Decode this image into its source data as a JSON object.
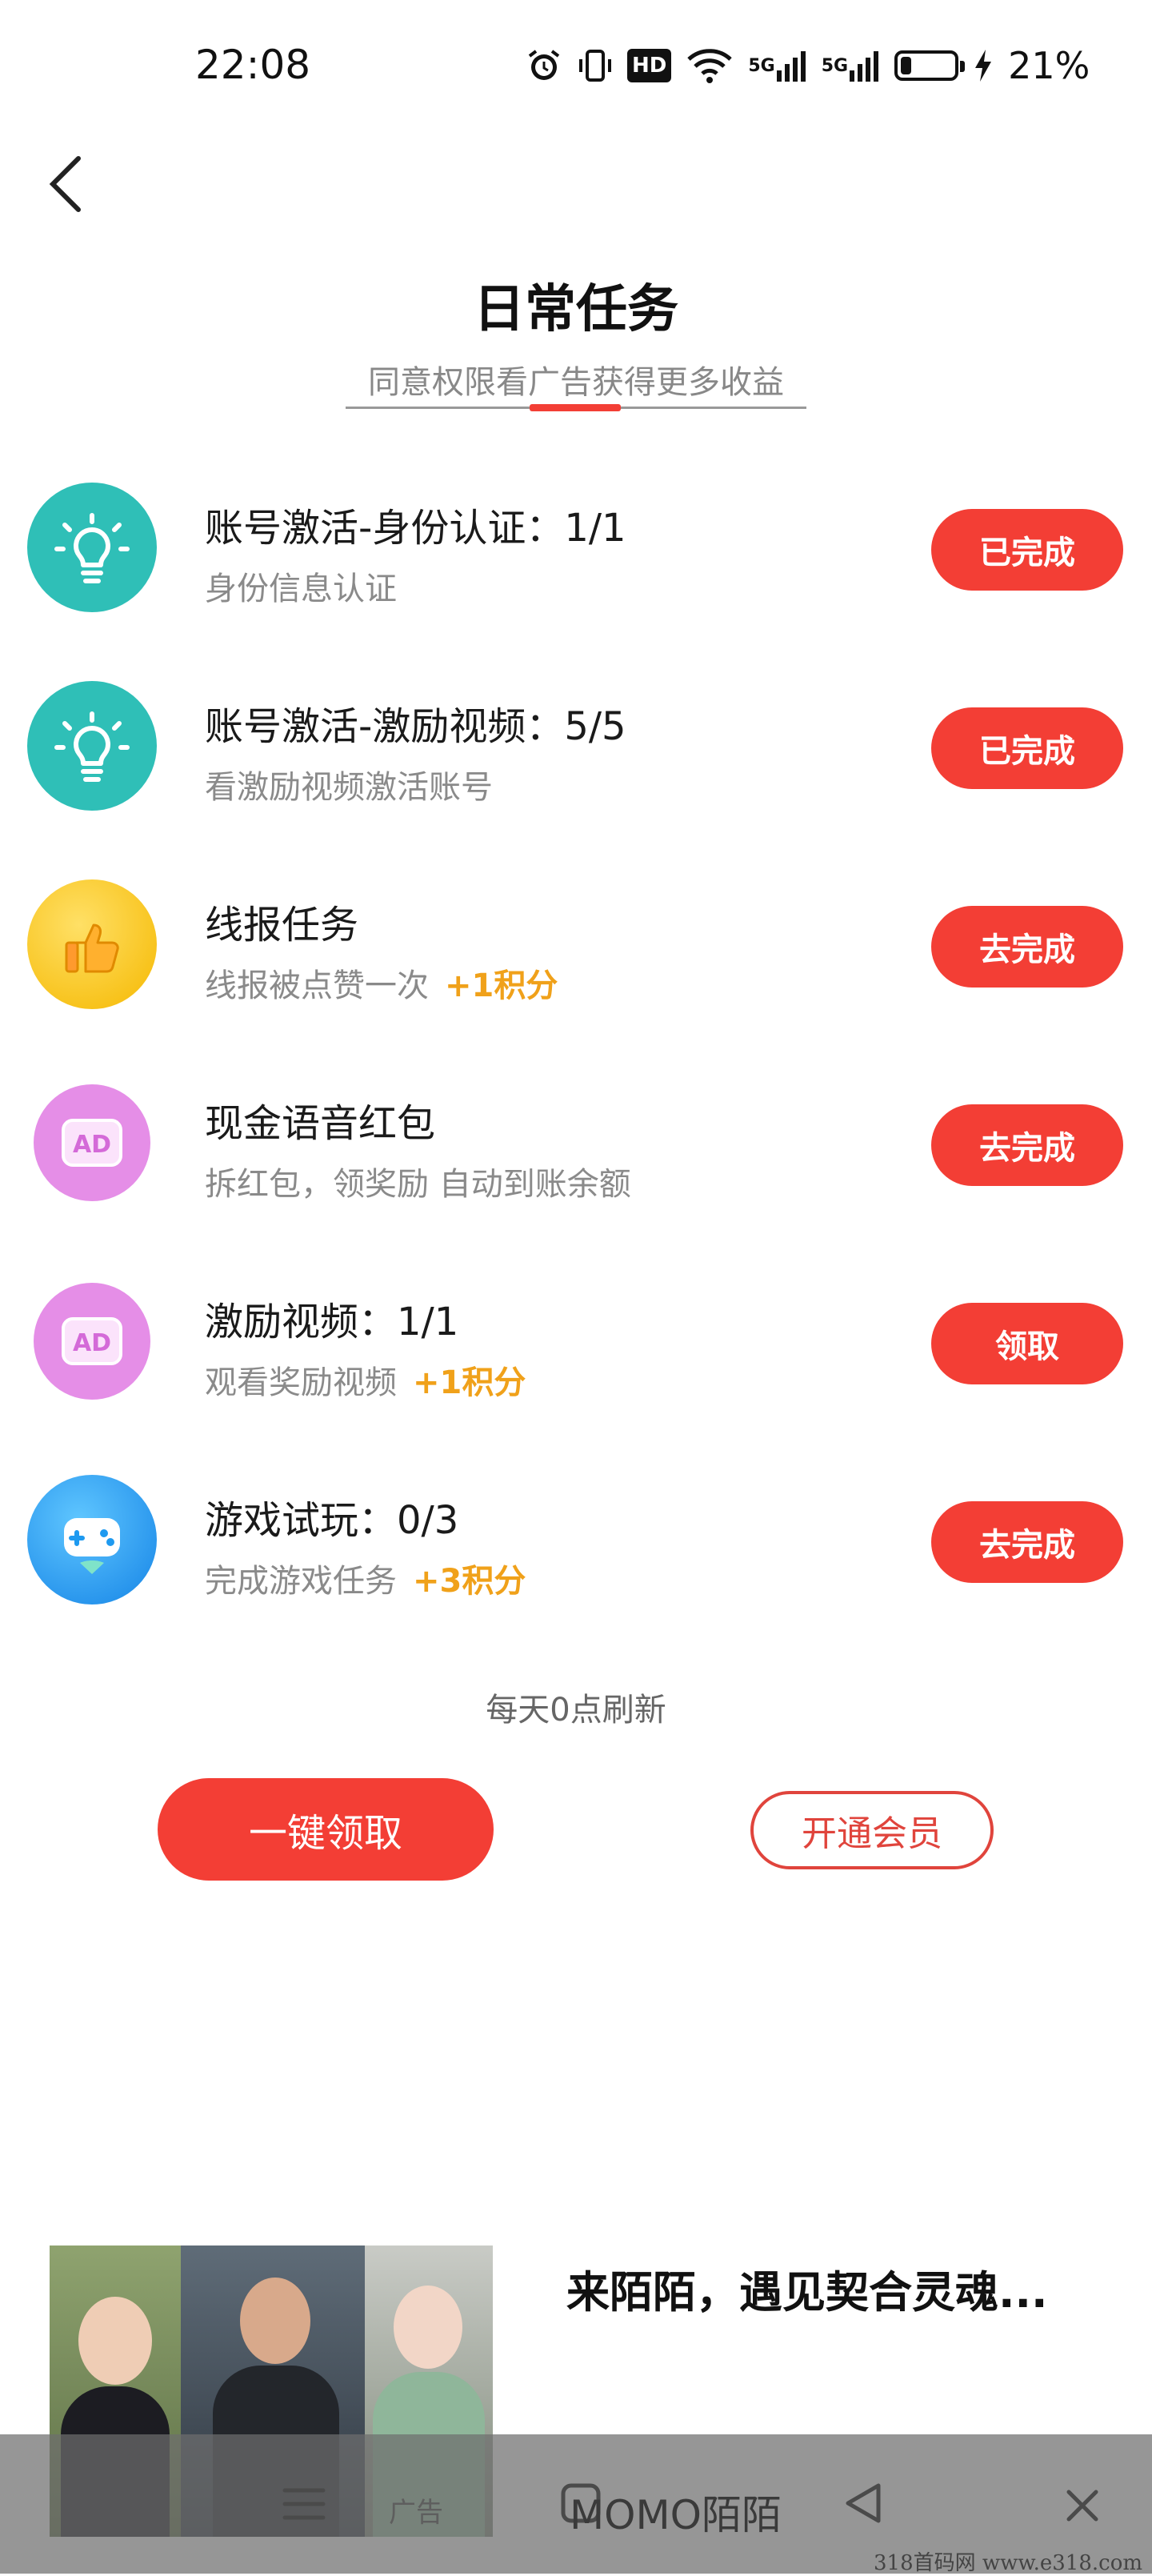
{
  "status_bar": {
    "time": "22:08",
    "battery_percent": "21%",
    "battery_level": 0.21,
    "icons": [
      "alarm-icon",
      "vibrate-icon",
      "hd-icon",
      "wifi-icon",
      "signal-5g-icon",
      "signal-5g-icon",
      "battery-icon",
      "charging-icon"
    ],
    "hd_label": "HD",
    "net_label_1": "5G",
    "net_label_2": "5G"
  },
  "header": {
    "title": "日常任务",
    "subtitle": "同意权限看广告获得更多收益"
  },
  "tasks": [
    {
      "icon": "lightbulb-icon",
      "title": "账号激活-身份认证：1/1",
      "desc": "身份信息认证",
      "bonus": "",
      "button": "已完成",
      "icon_color": "#2fbfb7"
    },
    {
      "icon": "lightbulb-icon",
      "title": "账号激活-激励视频：5/5",
      "desc": "看激励视频激活账号",
      "bonus": "",
      "button": "已完成",
      "icon_color": "#2fbfb7"
    },
    {
      "icon": "thumbs-up-icon",
      "title": "线报任务",
      "desc": "线报被点赞一次",
      "bonus": "+1积分",
      "button": "去完成",
      "icon_color": "#f7c51e"
    },
    {
      "icon": "ad-icon",
      "title": "现金语音红包",
      "desc": "拆红包，领奖励 自动到账余额",
      "bonus": "",
      "button": "去完成",
      "icon_color": "#e58ee7"
    },
    {
      "icon": "ad-icon",
      "title": "激励视频：1/1",
      "desc": "观看奖励视频",
      "bonus": "+1积分",
      "button": "领取",
      "icon_color": "#e58ee7"
    },
    {
      "icon": "gamepad-icon",
      "title": "游戏试玩：0/3",
      "desc": "完成游戏任务",
      "bonus": "+3积分",
      "button": "去完成",
      "icon_color": "#1e9af0"
    }
  ],
  "refresh_note": "每天0点刷新",
  "actions": {
    "claim_all": "一键领取",
    "vip": "开通会员"
  },
  "ad": {
    "title": "来陌陌，遇见契合灵魂...",
    "brand": "MOMO陌陌",
    "tag": "广告"
  },
  "watermark": "318首码网 www.e318.com",
  "colors": {
    "accent": "#f33e35",
    "bonus": "#f0a11a"
  }
}
